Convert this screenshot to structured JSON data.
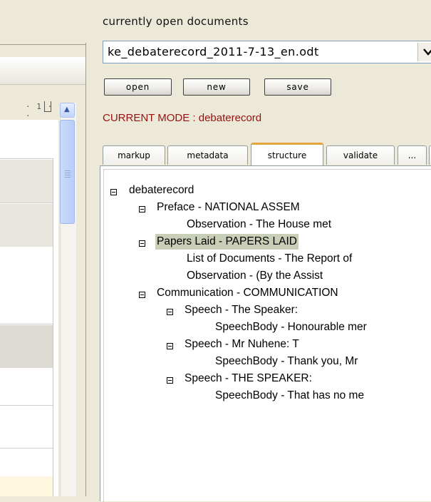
{
  "panel": {
    "title": "currently open documents",
    "selected_document": "ke_debaterecord_2011-7-13_en.odt",
    "buttons": {
      "open": "open",
      "new": "new",
      "save": "save"
    },
    "mode_text": "CURRENT MODE : debaterecord"
  },
  "tabs": [
    {
      "label": "markup"
    },
    {
      "label": "metadata"
    },
    {
      "label": "structure",
      "active": true
    },
    {
      "label": "validate"
    },
    {
      "label": "..."
    }
  ],
  "tree": [
    {
      "label": "debaterecord"
    },
    {
      "label": "Preface - NATIONAL ASSEM"
    },
    {
      "label": "Observation - The House met"
    },
    {
      "label": "Papers Laid - PAPERS  LAID",
      "selected": true
    },
    {
      "label": "List of Documents - The Report of"
    },
    {
      "label": "Observation - (By the Assist"
    },
    {
      "label": "Communication - COMMUNICATION"
    },
    {
      "label": "Speech - The Speaker:"
    },
    {
      "label": "SpeechBody - Honourable mer"
    },
    {
      "label": "Speech - Mr Nuhene: T"
    },
    {
      "label": "SpeechBody - Thank you, Mr"
    },
    {
      "label": "Speech - THE SPEAKER:"
    },
    {
      "label": "SpeechBody - That has no me"
    }
  ],
  "colors": {
    "mode_text": "#9a1010",
    "active_tab_accent": "#e6a23c",
    "selection_highlight": "#c9cfb7",
    "window_bg": "#ece9d8"
  },
  "icons": {
    "dropdown": "chevron-down-icon",
    "scroll_up": "scroll-up-arrow-icon",
    "tree_toggle": "collapse-minus-icon"
  }
}
